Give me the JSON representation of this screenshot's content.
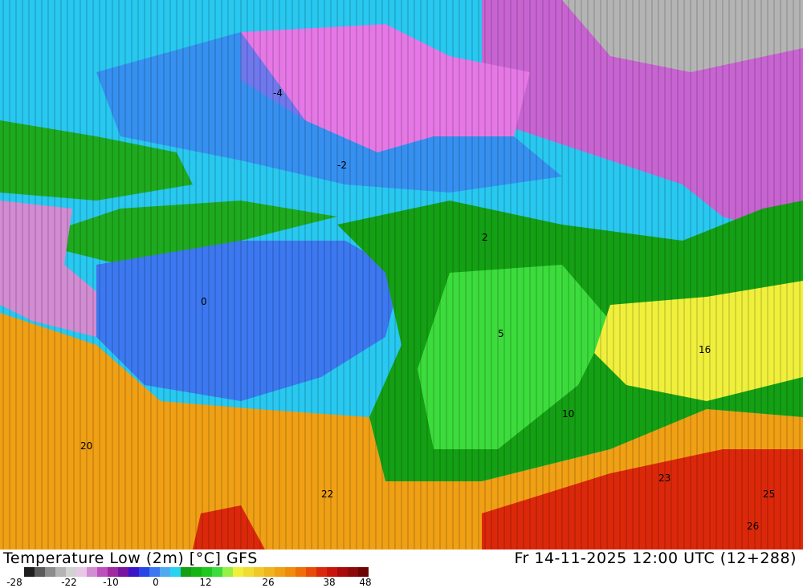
{
  "title": {
    "left": "Temperature Low (2m) [°C] GFS",
    "right": "Fr 14-11-2025 12:00 UTC (12+288)"
  },
  "legend": {
    "colors": [
      "#1e1e1e",
      "#5a5a5a",
      "#8c8c8c",
      "#b4b4b4",
      "#d2d2d2",
      "#e6c8e6",
      "#d28cd2",
      "#be50be",
      "#a028a0",
      "#7814a0",
      "#3c14c8",
      "#2846e6",
      "#3c78f0",
      "#50aaf0",
      "#28d2f0",
      "#14a014",
      "#14b414",
      "#1ec81e",
      "#3cdc3c",
      "#96f046",
      "#f0f03c",
      "#f0dc32",
      "#f0c828",
      "#f0b41e",
      "#f0a014",
      "#f08c0a",
      "#f06e0a",
      "#e64b0a",
      "#dc280a",
      "#c8140a",
      "#aa0a0a",
      "#8c0a0a",
      "#6e0505"
    ],
    "tick_labels": [
      "-28",
      "-22",
      "-10",
      "0",
      "12",
      "26",
      "38",
      "48"
    ]
  },
  "map": {
    "regions": [
      "cold-north-belt",
      "cold-western-basin",
      "cool-central-plain",
      "green-southern-plain",
      "yellow-east-coast",
      "warm-southern-band"
    ],
    "contour_labels": [
      "-2",
      "-4",
      "0",
      "2",
      "5",
      "10",
      "16",
      "20",
      "22",
      "23",
      "25",
      "26"
    ]
  }
}
